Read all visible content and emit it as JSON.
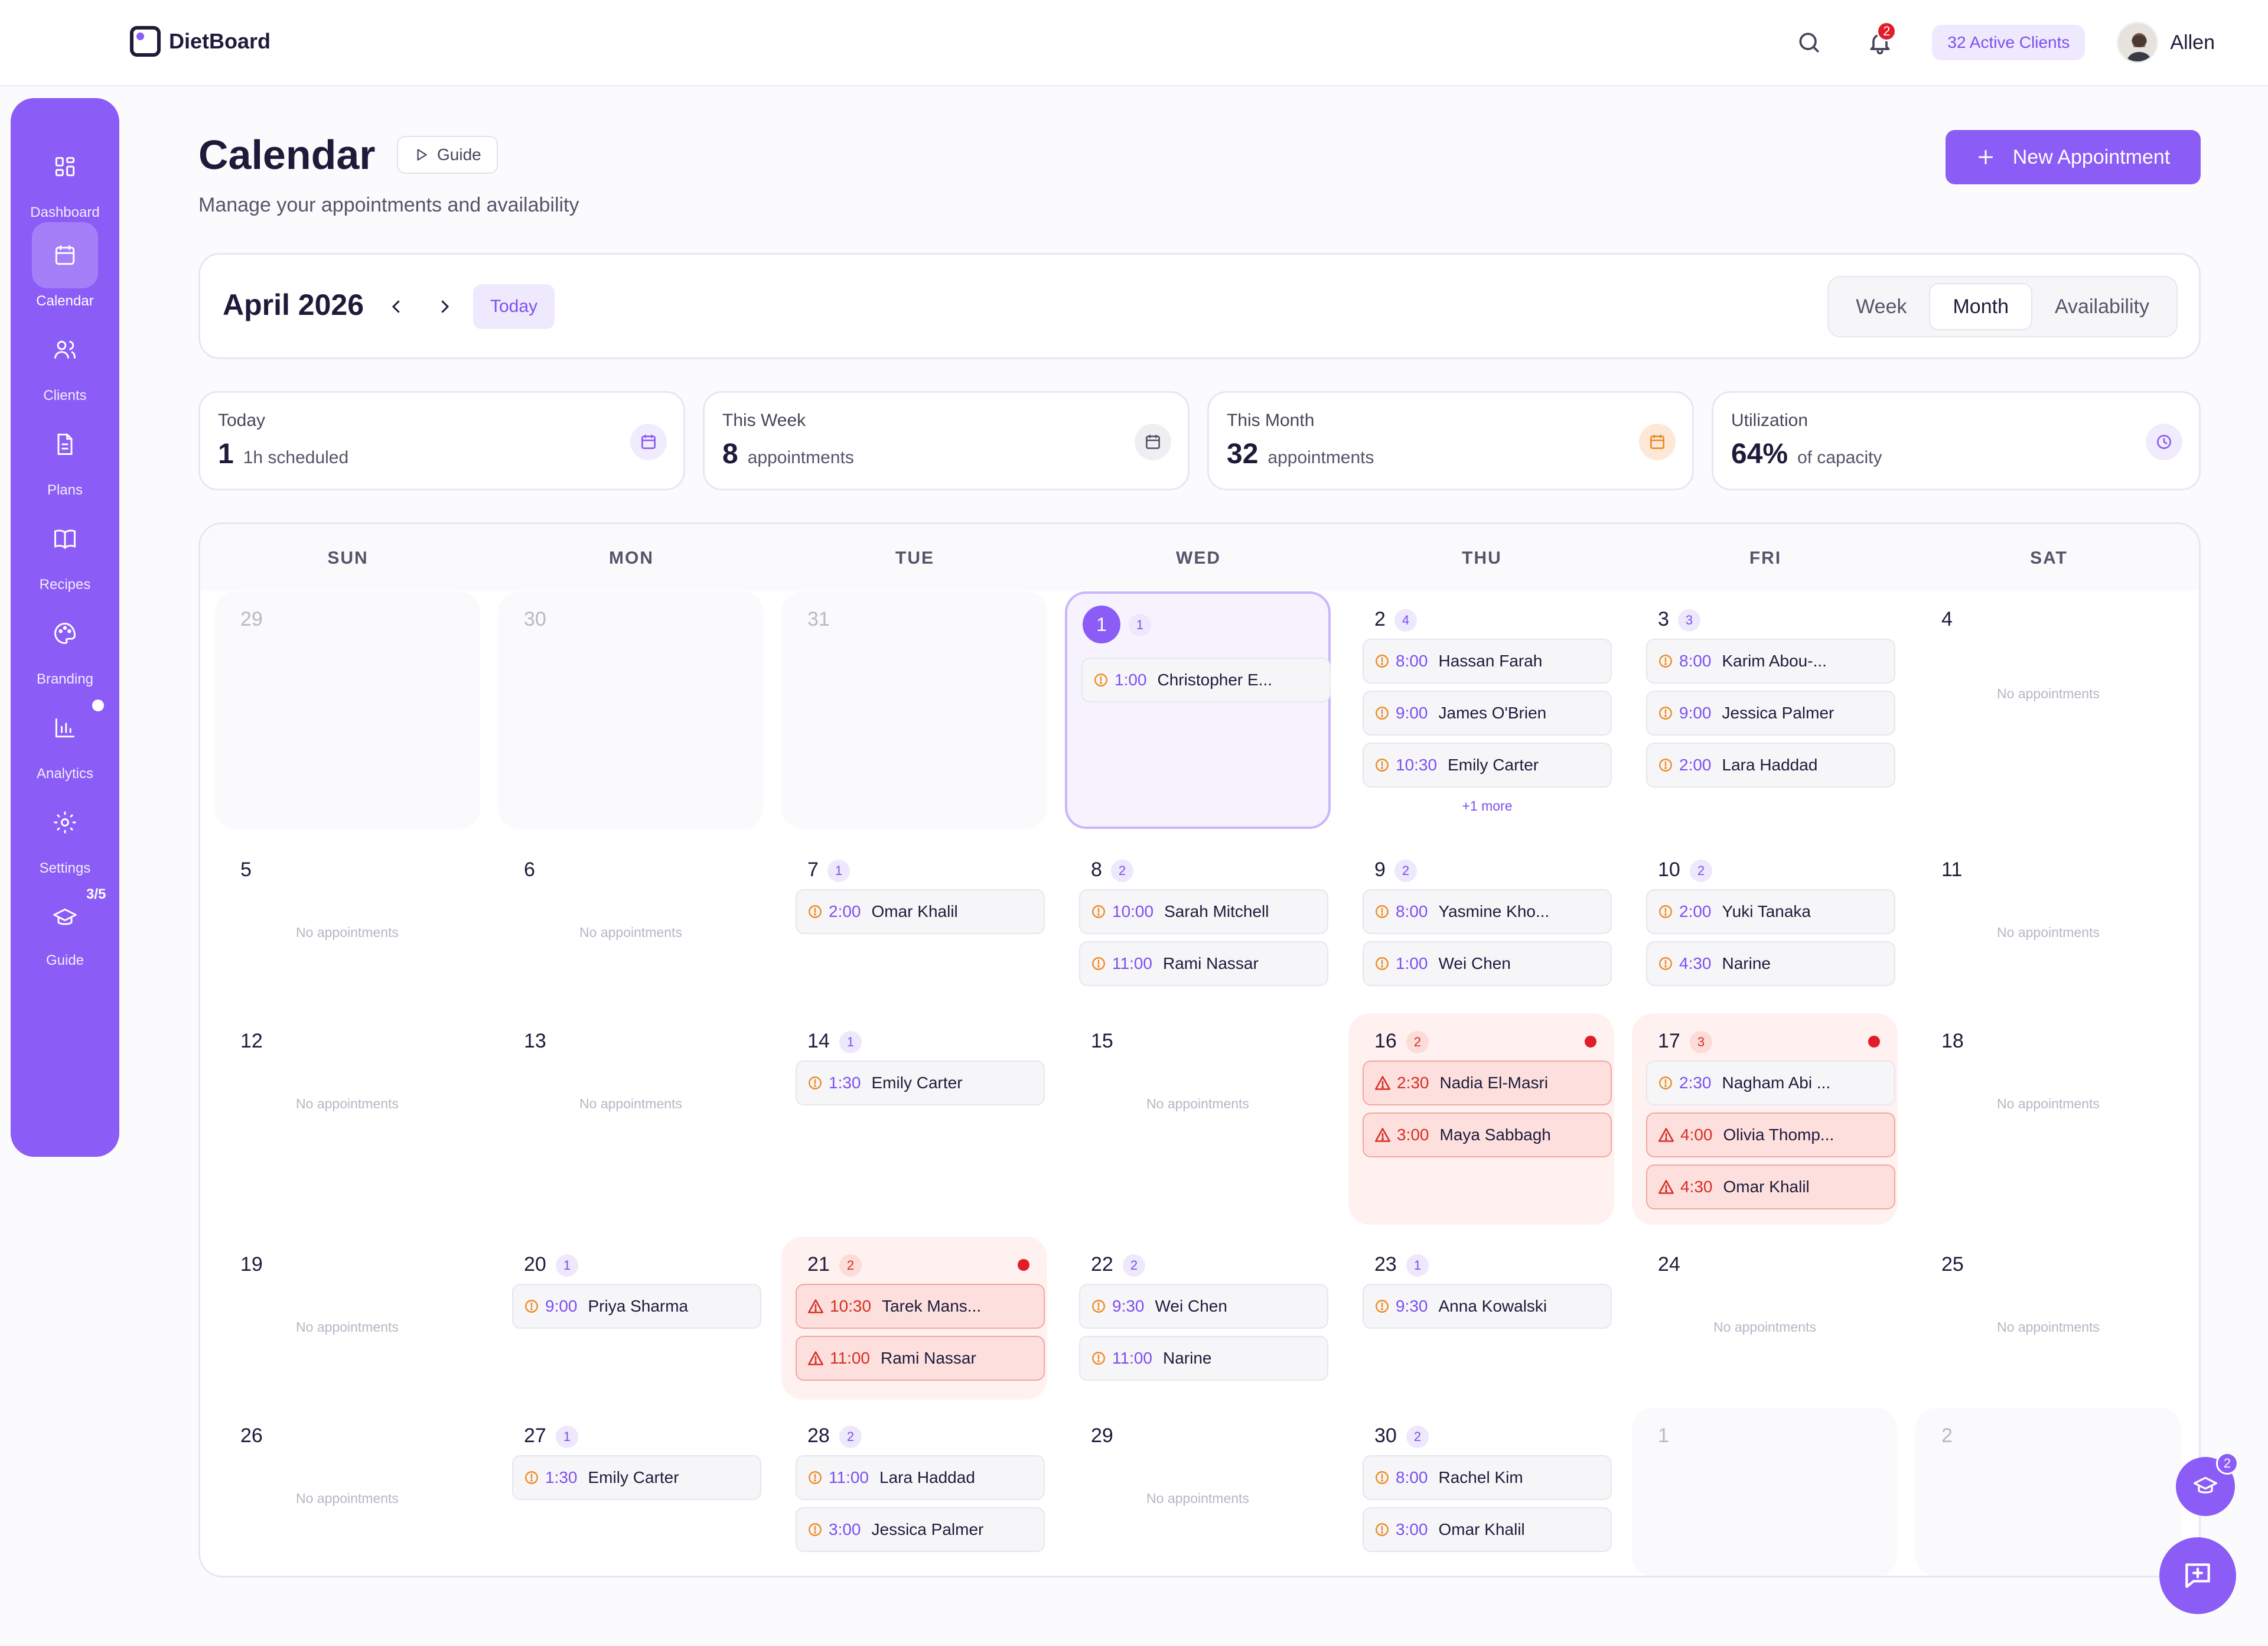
{
  "app": {
    "name": "DietBoard"
  },
  "topbar": {
    "notifications": "2",
    "active_clients": "32 Active Clients",
    "user": "Allen"
  },
  "sidebar": {
    "items": [
      {
        "label": "Dashboard",
        "icon": "grid-icon"
      },
      {
        "label": "Calendar",
        "icon": "calendar-icon",
        "active": true
      },
      {
        "label": "Clients",
        "icon": "users-icon"
      },
      {
        "label": "Plans",
        "icon": "file-icon"
      },
      {
        "label": "Recipes",
        "icon": "book-icon"
      },
      {
        "label": "Branding",
        "icon": "palette-icon"
      },
      {
        "label": "Analytics",
        "icon": "bar-chart-icon"
      },
      {
        "label": "Settings",
        "icon": "gear-icon"
      },
      {
        "label": "Guide",
        "icon": "graduation-cap-icon"
      }
    ],
    "guide_progress": "3/5"
  },
  "page": {
    "title": "Calendar",
    "guide": "Guide",
    "subtitle": "Manage your appointments and availability",
    "new_appointment": "New Appointment"
  },
  "calendar_header": {
    "month": "April 2026",
    "today": "Today",
    "views": [
      "Week",
      "Month",
      "Availability"
    ],
    "active_view": "Month"
  },
  "stats": [
    {
      "label": "Today",
      "value": "1",
      "unit": "1h scheduled",
      "color": "#8b5cf6"
    },
    {
      "label": "This Week",
      "value": "8",
      "unit": "appointments",
      "color": "#55546a"
    },
    {
      "label": "This Month",
      "value": "32",
      "unit": "appointments",
      "color": "#f08a24"
    },
    {
      "label": "Utilization",
      "value": "64%",
      "unit": "of capacity",
      "color": "#8b5cf6"
    }
  ],
  "weekdays": [
    "SUN",
    "MON",
    "TUE",
    "WED",
    "THU",
    "FRI",
    "SAT"
  ],
  "no_appointments": "No appointments",
  "more_label": "+1 more",
  "colors": {
    "accent": "#8b5cf6",
    "alert": "#d62e25",
    "pending": "#f08a24"
  },
  "weeks": [
    [
      {
        "num": "29",
        "other": true,
        "appts": []
      },
      {
        "num": "30",
        "other": true,
        "appts": []
      },
      {
        "num": "31",
        "other": true,
        "appts": []
      },
      {
        "num": "1",
        "today": true,
        "count": "1",
        "appts": [
          {
            "time": "1:00",
            "name": "Christopher E..."
          }
        ]
      },
      {
        "num": "2",
        "count": "4",
        "appts": [
          {
            "time": "8:00",
            "name": "Hassan Farah"
          },
          {
            "time": "9:00",
            "name": "James O'Brien"
          },
          {
            "time": "10:30",
            "name": "Emily Carter"
          }
        ],
        "more": true
      },
      {
        "num": "3",
        "count": "3",
        "appts": [
          {
            "time": "8:00",
            "name": "Karim Abou-..."
          },
          {
            "time": "9:00",
            "name": "Jessica Palmer"
          },
          {
            "time": "2:00",
            "name": "Lara Haddad"
          }
        ]
      },
      {
        "num": "4",
        "appts": []
      }
    ],
    [
      {
        "num": "5",
        "appts": []
      },
      {
        "num": "6",
        "appts": []
      },
      {
        "num": "7",
        "count": "1",
        "appts": [
          {
            "time": "2:00",
            "name": "Omar Khalil"
          }
        ]
      },
      {
        "num": "8",
        "count": "2",
        "appts": [
          {
            "time": "10:00",
            "name": "Sarah Mitchell"
          },
          {
            "time": "11:00",
            "name": "Rami Nassar"
          }
        ]
      },
      {
        "num": "9",
        "count": "2",
        "appts": [
          {
            "time": "8:00",
            "name": "Yasmine Kho..."
          },
          {
            "time": "1:00",
            "name": "Wei Chen"
          }
        ]
      },
      {
        "num": "10",
        "count": "2",
        "appts": [
          {
            "time": "2:00",
            "name": "Yuki Tanaka"
          },
          {
            "time": "4:30",
            "name": "Narine"
          }
        ]
      },
      {
        "num": "11",
        "appts": []
      }
    ],
    [
      {
        "num": "12",
        "appts": []
      },
      {
        "num": "13",
        "appts": []
      },
      {
        "num": "14",
        "count": "1",
        "appts": [
          {
            "time": "1:30",
            "name": "Emily Carter"
          }
        ]
      },
      {
        "num": "15",
        "appts": []
      },
      {
        "num": "16",
        "count": "2",
        "alert": true,
        "appts": [
          {
            "time": "2:30",
            "name": "Nadia El-Masri",
            "alert": true
          },
          {
            "time": "3:00",
            "name": "Maya Sabbagh",
            "alert": true
          }
        ]
      },
      {
        "num": "17",
        "count": "3",
        "alert": true,
        "appts": [
          {
            "time": "2:30",
            "name": "Nagham Abi ..."
          },
          {
            "time": "4:00",
            "name": "Olivia Thomp...",
            "alert": true
          },
          {
            "time": "4:30",
            "name": "Omar Khalil",
            "alert": true
          }
        ]
      },
      {
        "num": "18",
        "appts": []
      }
    ],
    [
      {
        "num": "19",
        "appts": []
      },
      {
        "num": "20",
        "count": "1",
        "appts": [
          {
            "time": "9:00",
            "name": "Priya Sharma"
          }
        ]
      },
      {
        "num": "21",
        "count": "2",
        "alert": true,
        "appts": [
          {
            "time": "10:30",
            "name": "Tarek Mans...",
            "alert": true
          },
          {
            "time": "11:00",
            "name": "Rami Nassar",
            "alert": true
          }
        ]
      },
      {
        "num": "22",
        "count": "2",
        "appts": [
          {
            "time": "9:30",
            "name": "Wei Chen"
          },
          {
            "time": "11:00",
            "name": "Narine"
          }
        ]
      },
      {
        "num": "23",
        "count": "1",
        "appts": [
          {
            "time": "9:30",
            "name": "Anna Kowalski"
          }
        ]
      },
      {
        "num": "24",
        "appts": []
      },
      {
        "num": "25",
        "appts": []
      }
    ],
    [
      {
        "num": "26",
        "appts": []
      },
      {
        "num": "27",
        "count": "1",
        "appts": [
          {
            "time": "1:30",
            "name": "Emily Carter"
          }
        ]
      },
      {
        "num": "28",
        "count": "2",
        "appts": [
          {
            "time": "11:00",
            "name": "Lara Haddad"
          },
          {
            "time": "3:00",
            "name": "Jessica Palmer"
          }
        ]
      },
      {
        "num": "29",
        "appts": []
      },
      {
        "num": "30",
        "count": "2",
        "appts": [
          {
            "time": "8:00",
            "name": "Rachel Kim"
          },
          {
            "time": "3:00",
            "name": "Omar Khalil"
          }
        ]
      },
      {
        "num": "1",
        "other": true,
        "appts": []
      },
      {
        "num": "2",
        "other": true,
        "appts": []
      }
    ]
  ],
  "fab": {
    "guide_badge": "2"
  }
}
